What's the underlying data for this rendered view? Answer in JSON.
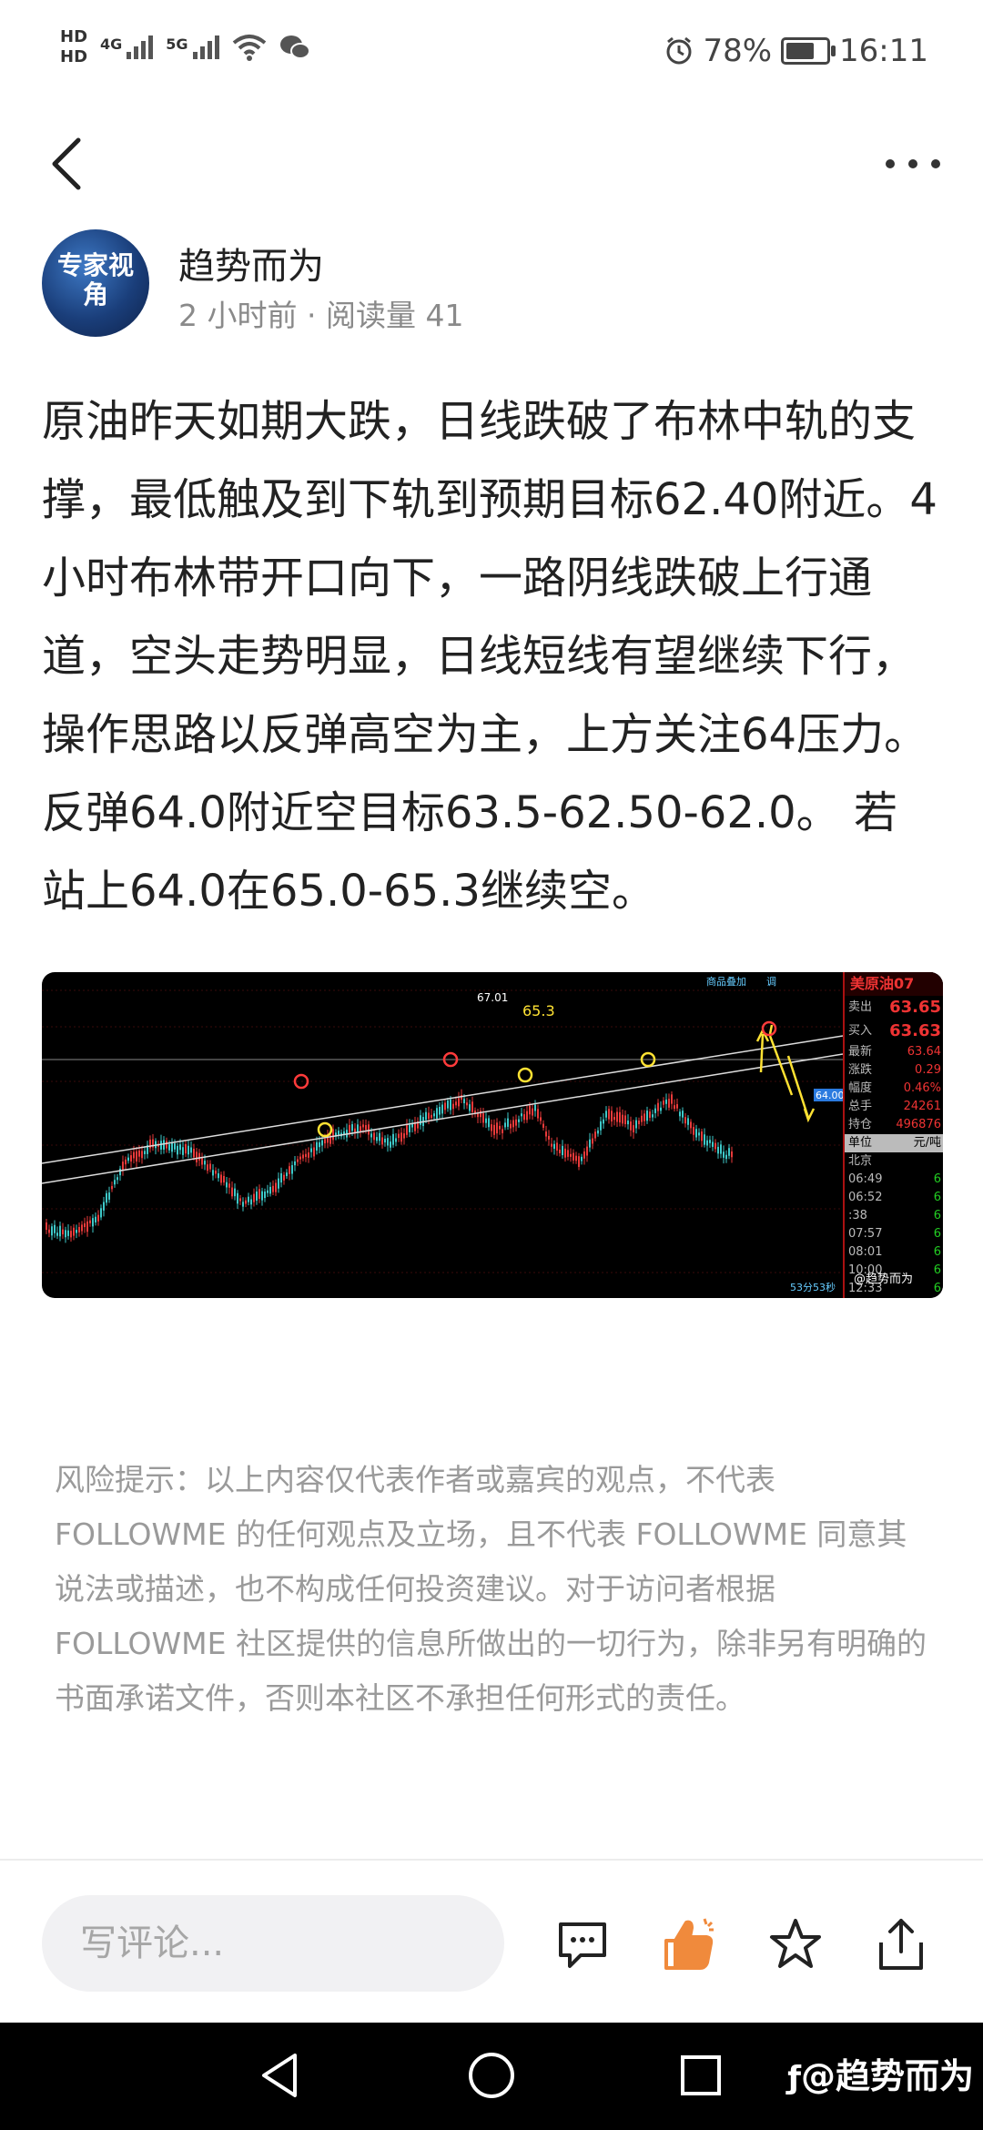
{
  "status_bar": {
    "hd1": "HD",
    "hd2": "HD",
    "net1": "4G",
    "net2": "5G",
    "battery": "78%",
    "time": "16:11"
  },
  "author": {
    "avatar_text": "专家视角",
    "name": "趋势而为",
    "meta": "2 小时前 · 阅读量 41"
  },
  "article": {
    "body": "原油昨天如期大跌，日线跌破了布林中轨的支撑，最低触及到下轨到预期目标62.40附近。4小时布林带开口向下，一路阴线跌破上行通道，空头走势明显，日线短线有望继续下行，操作思路以反弹高空为主，上方关注64压力。 反弹64.0附近空目标63.5-62.50-62.0。 若站上64.0在65.0-65.3继续空。"
  },
  "chart": {
    "peak_label": "67.01",
    "target_label": "65.3",
    "line_label": "64.00",
    "top_btn1": "商品叠加",
    "top_btn2": "调",
    "countdown": "53分53秒",
    "watermark": "@趋势而为",
    "side_title": "美原油07",
    "sell_label": "卖出",
    "sell_value": "63.65",
    "buy_label": "买入",
    "buy_value": "63.63",
    "rows": [
      {
        "k": "最新",
        "v": "63.64"
      },
      {
        "k": "涨跌",
        "v": "0.29"
      },
      {
        "k": "幅度",
        "v": "0.46%"
      },
      {
        "k": "总手",
        "v": "24261"
      },
      {
        "k": "持仓",
        "v": "496876"
      }
    ],
    "unit_label": "单位",
    "unit_value": "元/吨",
    "city": "北京",
    "times": [
      "06:49",
      "06:52",
      ":38",
      "07:57",
      "08:01",
      "10:00",
      "12:33"
    ]
  },
  "disclaimer": "风险提示：以上内容仅代表作者或嘉宾的观点，不代表 FOLLOWME 的任何观点及立场，且不代表 FOLLOWME 同意其说法或描述，也不构成任何投资建议。对于访问者根据 FOLLOWME 社区提供的信息所做出的一切行为，除非另有明确的书面承诺文件，否则本社区不承担任何形式的责任。",
  "bottom_bar": {
    "comment_placeholder": "写评论..."
  },
  "system": {
    "watermark": "@趋势而为"
  },
  "colors": {
    "like_orange": "#f08a3c",
    "chart_up": "#e83a3a",
    "chart_down": "#3ec8c8",
    "circle_yellow": "#ffe233",
    "circle_red": "#ff3b3b"
  }
}
